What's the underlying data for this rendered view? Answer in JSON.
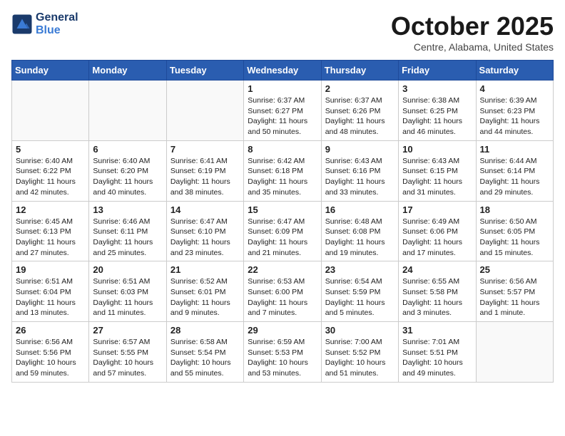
{
  "logo": {
    "line1": "General",
    "line2": "Blue"
  },
  "title": "October 2025",
  "location": "Centre, Alabama, United States",
  "days_header": [
    "Sunday",
    "Monday",
    "Tuesday",
    "Wednesday",
    "Thursday",
    "Friday",
    "Saturday"
  ],
  "weeks": [
    [
      {
        "day": "",
        "detail": ""
      },
      {
        "day": "",
        "detail": ""
      },
      {
        "day": "",
        "detail": ""
      },
      {
        "day": "1",
        "detail": "Sunrise: 6:37 AM\nSunset: 6:27 PM\nDaylight: 11 hours\nand 50 minutes."
      },
      {
        "day": "2",
        "detail": "Sunrise: 6:37 AM\nSunset: 6:26 PM\nDaylight: 11 hours\nand 48 minutes."
      },
      {
        "day": "3",
        "detail": "Sunrise: 6:38 AM\nSunset: 6:25 PM\nDaylight: 11 hours\nand 46 minutes."
      },
      {
        "day": "4",
        "detail": "Sunrise: 6:39 AM\nSunset: 6:23 PM\nDaylight: 11 hours\nand 44 minutes."
      }
    ],
    [
      {
        "day": "5",
        "detail": "Sunrise: 6:40 AM\nSunset: 6:22 PM\nDaylight: 11 hours\nand 42 minutes."
      },
      {
        "day": "6",
        "detail": "Sunrise: 6:40 AM\nSunset: 6:20 PM\nDaylight: 11 hours\nand 40 minutes."
      },
      {
        "day": "7",
        "detail": "Sunrise: 6:41 AM\nSunset: 6:19 PM\nDaylight: 11 hours\nand 38 minutes."
      },
      {
        "day": "8",
        "detail": "Sunrise: 6:42 AM\nSunset: 6:18 PM\nDaylight: 11 hours\nand 35 minutes."
      },
      {
        "day": "9",
        "detail": "Sunrise: 6:43 AM\nSunset: 6:16 PM\nDaylight: 11 hours\nand 33 minutes."
      },
      {
        "day": "10",
        "detail": "Sunrise: 6:43 AM\nSunset: 6:15 PM\nDaylight: 11 hours\nand 31 minutes."
      },
      {
        "day": "11",
        "detail": "Sunrise: 6:44 AM\nSunset: 6:14 PM\nDaylight: 11 hours\nand 29 minutes."
      }
    ],
    [
      {
        "day": "12",
        "detail": "Sunrise: 6:45 AM\nSunset: 6:13 PM\nDaylight: 11 hours\nand 27 minutes."
      },
      {
        "day": "13",
        "detail": "Sunrise: 6:46 AM\nSunset: 6:11 PM\nDaylight: 11 hours\nand 25 minutes."
      },
      {
        "day": "14",
        "detail": "Sunrise: 6:47 AM\nSunset: 6:10 PM\nDaylight: 11 hours\nand 23 minutes."
      },
      {
        "day": "15",
        "detail": "Sunrise: 6:47 AM\nSunset: 6:09 PM\nDaylight: 11 hours\nand 21 minutes."
      },
      {
        "day": "16",
        "detail": "Sunrise: 6:48 AM\nSunset: 6:08 PM\nDaylight: 11 hours\nand 19 minutes."
      },
      {
        "day": "17",
        "detail": "Sunrise: 6:49 AM\nSunset: 6:06 PM\nDaylight: 11 hours\nand 17 minutes."
      },
      {
        "day": "18",
        "detail": "Sunrise: 6:50 AM\nSunset: 6:05 PM\nDaylight: 11 hours\nand 15 minutes."
      }
    ],
    [
      {
        "day": "19",
        "detail": "Sunrise: 6:51 AM\nSunset: 6:04 PM\nDaylight: 11 hours\nand 13 minutes."
      },
      {
        "day": "20",
        "detail": "Sunrise: 6:51 AM\nSunset: 6:03 PM\nDaylight: 11 hours\nand 11 minutes."
      },
      {
        "day": "21",
        "detail": "Sunrise: 6:52 AM\nSunset: 6:01 PM\nDaylight: 11 hours\nand 9 minutes."
      },
      {
        "day": "22",
        "detail": "Sunrise: 6:53 AM\nSunset: 6:00 PM\nDaylight: 11 hours\nand 7 minutes."
      },
      {
        "day": "23",
        "detail": "Sunrise: 6:54 AM\nSunset: 5:59 PM\nDaylight: 11 hours\nand 5 minutes."
      },
      {
        "day": "24",
        "detail": "Sunrise: 6:55 AM\nSunset: 5:58 PM\nDaylight: 11 hours\nand 3 minutes."
      },
      {
        "day": "25",
        "detail": "Sunrise: 6:56 AM\nSunset: 5:57 PM\nDaylight: 11 hours\nand 1 minute."
      }
    ],
    [
      {
        "day": "26",
        "detail": "Sunrise: 6:56 AM\nSunset: 5:56 PM\nDaylight: 10 hours\nand 59 minutes."
      },
      {
        "day": "27",
        "detail": "Sunrise: 6:57 AM\nSunset: 5:55 PM\nDaylight: 10 hours\nand 57 minutes."
      },
      {
        "day": "28",
        "detail": "Sunrise: 6:58 AM\nSunset: 5:54 PM\nDaylight: 10 hours\nand 55 minutes."
      },
      {
        "day": "29",
        "detail": "Sunrise: 6:59 AM\nSunset: 5:53 PM\nDaylight: 10 hours\nand 53 minutes."
      },
      {
        "day": "30",
        "detail": "Sunrise: 7:00 AM\nSunset: 5:52 PM\nDaylight: 10 hours\nand 51 minutes."
      },
      {
        "day": "31",
        "detail": "Sunrise: 7:01 AM\nSunset: 5:51 PM\nDaylight: 10 hours\nand 49 minutes."
      },
      {
        "day": "",
        "detail": ""
      }
    ]
  ]
}
